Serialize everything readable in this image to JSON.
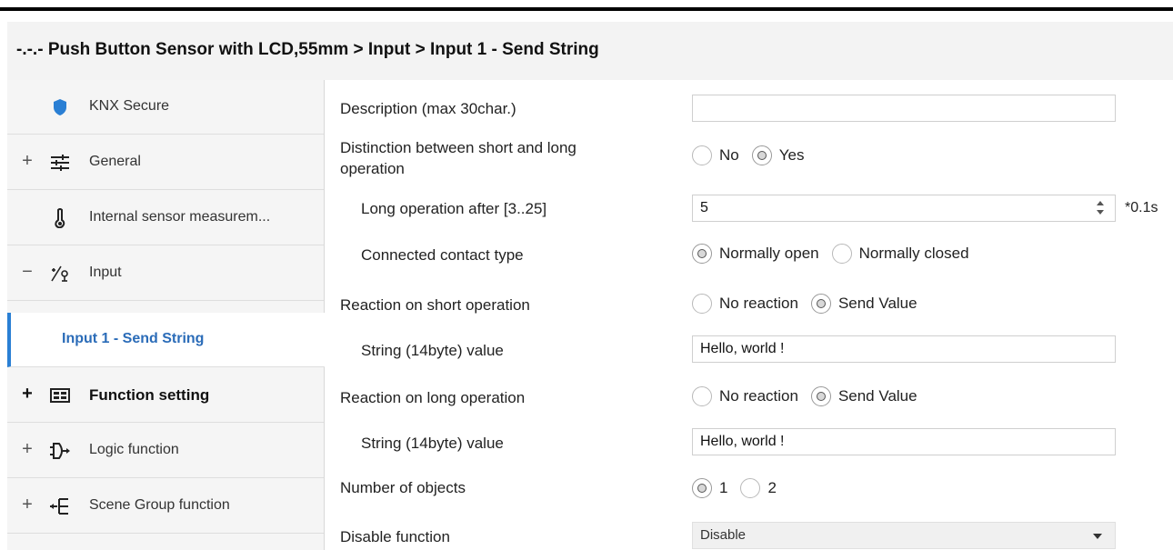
{
  "breadcrumb": "-.-.- Push Button Sensor with LCD,55mm > Input > Input 1 - Send String",
  "sidebar": {
    "items": [
      {
        "label": "KNX Secure",
        "icon": "shield-icon"
      },
      {
        "label": "General",
        "icon": "sliders-icon",
        "expander": "+"
      },
      {
        "label": "Internal sensor measurem...",
        "icon": "thermometer-icon"
      },
      {
        "label": "Input",
        "icon": "input-switch-icon",
        "expander": "−"
      },
      {
        "label": "Input 1 - Send String"
      },
      {
        "label": "Function setting",
        "icon": "function-grid-icon",
        "expander": "+"
      },
      {
        "label": "Logic function",
        "icon": "logic-gate-icon",
        "expander": "+"
      },
      {
        "label": "Scene Group function",
        "icon": "scene-group-icon",
        "expander": "+"
      }
    ]
  },
  "params": {
    "description": {
      "label": "Description (max 30char.)",
      "value": ""
    },
    "distinction": {
      "label_line1": "Distinction between short and long",
      "label_line2": "operation",
      "options": [
        "No",
        "Yes"
      ],
      "selected": "Yes"
    },
    "long_after": {
      "label": "Long operation after [3..25]",
      "value": "5",
      "unit": "*0.1s"
    },
    "contact_type": {
      "label": "Connected contact type",
      "options": [
        "Normally open",
        "Normally closed"
      ],
      "selected": "Normally open"
    },
    "short_reaction": {
      "label": "Reaction on short operation",
      "options": [
        "No reaction",
        "Send Value"
      ],
      "selected": "Send Value"
    },
    "short_string": {
      "label": "String (14byte) value",
      "value": "Hello, world !"
    },
    "long_reaction": {
      "label": "Reaction on long operation",
      "options": [
        "No reaction",
        "Send Value"
      ],
      "selected": "Send Value"
    },
    "long_string": {
      "label": "String (14byte) value",
      "value": "Hello, world !"
    },
    "objects": {
      "label": "Number of objects",
      "options": [
        "1",
        "2"
      ],
      "selected": "1"
    },
    "disable": {
      "label": "Disable function",
      "value": "Disable"
    }
  }
}
